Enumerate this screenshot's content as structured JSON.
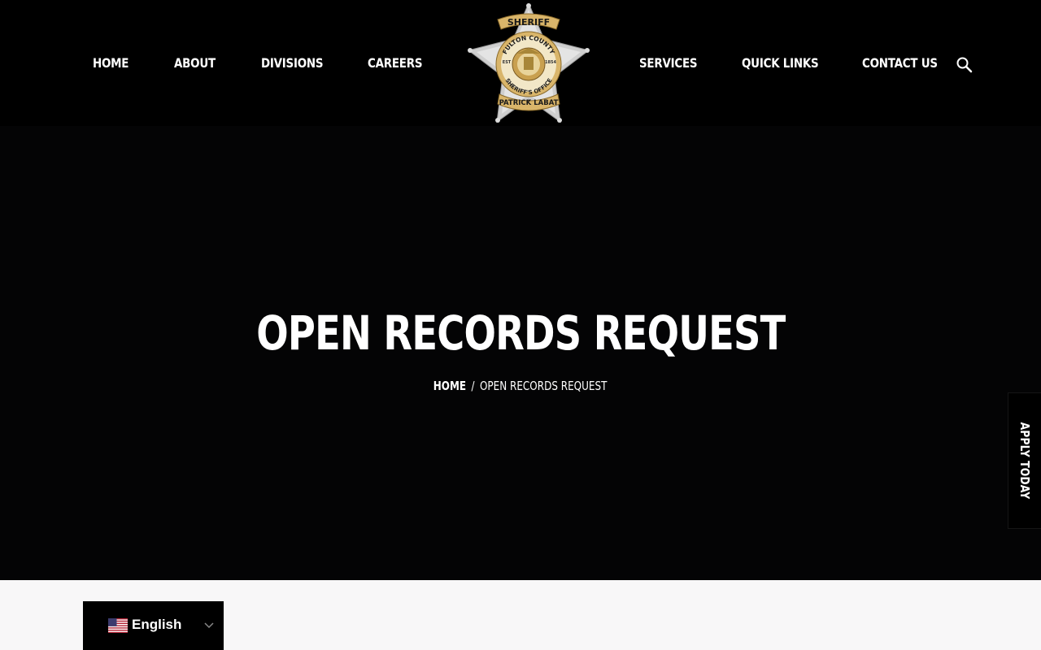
{
  "nav": {
    "left": [
      {
        "label": "HOME"
      },
      {
        "label": "ABOUT"
      },
      {
        "label": "DIVISIONS"
      },
      {
        "label": "CAREERS"
      }
    ],
    "right": [
      {
        "label": "SERVICES"
      },
      {
        "label": "QUICK LINKS"
      },
      {
        "label": "CONTACT US"
      }
    ],
    "search_icon": "search-icon"
  },
  "badge": {
    "top_text": "SHERIFF",
    "arc_top": "FULTON COUNTY",
    "arc_bottom": "SHERIFF'S OFFICE",
    "banner": "PATRICK LABAT",
    "est": "EST",
    "year": "1854",
    "colors": {
      "gold": "#d9b56a",
      "silver": "#d7d7d7"
    }
  },
  "hero": {
    "title": "OPEN RECORDS REQUEST",
    "breadcrumb_home": "HOME",
    "breadcrumb_sep": "/",
    "breadcrumb_current": "OPEN RECORDS REQUEST"
  },
  "apply_tab": {
    "label": "APPLY TODAY"
  },
  "language": {
    "selected": "English",
    "flag_icon": "us-flag-icon"
  },
  "colors": {
    "background": "#000000",
    "hero": "#040405",
    "content": "#f8f7f8",
    "text": "#ffffff"
  }
}
